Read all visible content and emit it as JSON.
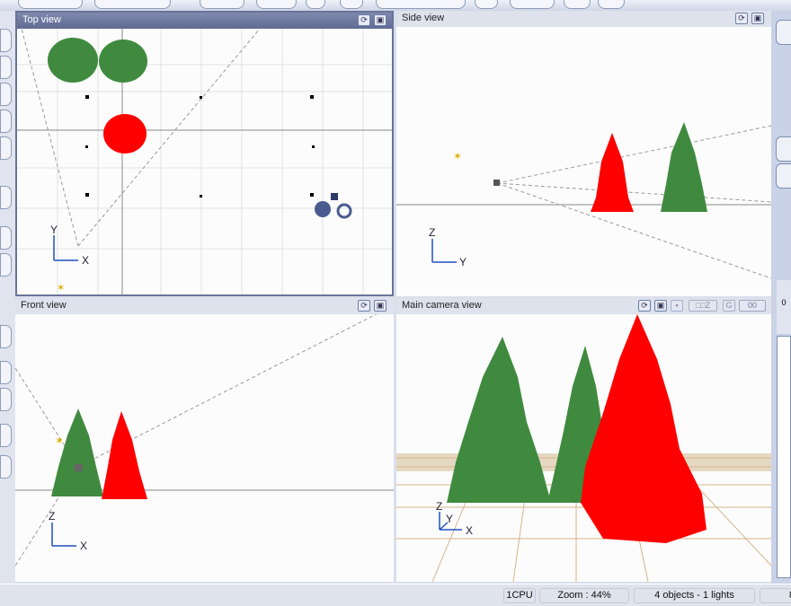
{
  "views": {
    "top": {
      "title": "Top view",
      "axis_v": "Y",
      "axis_h": "X"
    },
    "side": {
      "title": "Side view",
      "axis_v": "Z",
      "axis_h": "Y"
    },
    "front": {
      "title": "Front view",
      "axis_v": "Z",
      "axis_h": "X"
    },
    "camera": {
      "title": "Main camera view",
      "axis_v": "Z",
      "axis_d": "Y",
      "axis_h": "X",
      "frame_counter": "00"
    }
  },
  "right_panel": {
    "value": "0"
  },
  "status": {
    "cpu": "1CPU",
    "zoom": "Zoom : 44%",
    "scene": "4 objects - 1 lights",
    "extra": "8"
  },
  "colors": {
    "tree_green": "#3f8a3f",
    "tree_red": "#ff0000",
    "header_active": "#6a7399"
  }
}
